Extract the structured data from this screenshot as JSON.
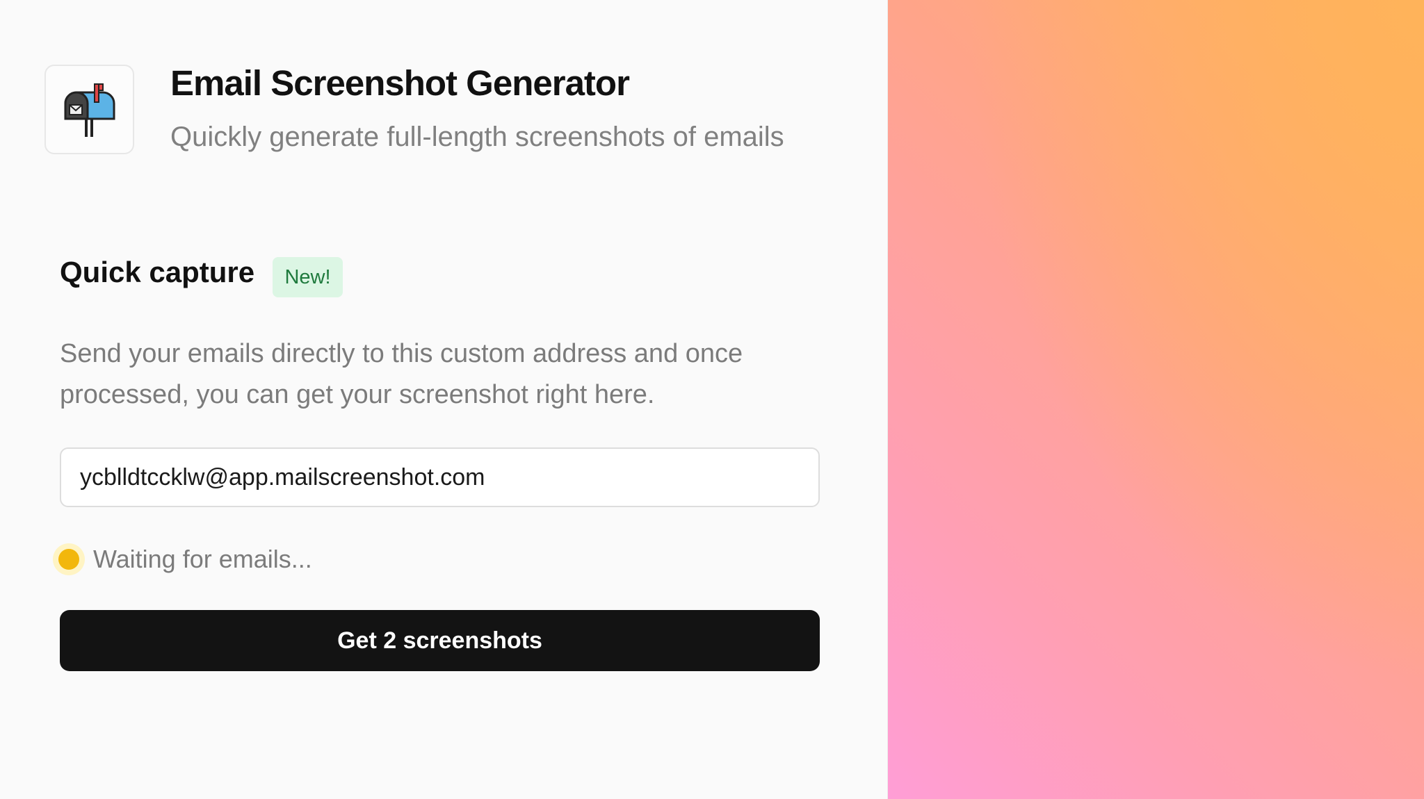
{
  "header": {
    "icon": "mailbox-icon",
    "title": "Email Screenshot Generator",
    "subtitle": "Quickly generate full-length screenshots of emails"
  },
  "quick_capture": {
    "title": "Quick capture",
    "badge": "New!",
    "description": "Send your emails directly to this custom address and once processed, you can get your screenshot right here.",
    "email_value": "ycblldtccklw@app.mailscreenshot.com",
    "status_text": "Waiting for emails...",
    "status_color": "#f2b70c",
    "button_label": "Get 2 screenshots"
  },
  "colors": {
    "badge_bg": "#dcf6e4",
    "badge_text": "#1f7a3d",
    "button_bg": "#131313",
    "gradient": [
      "#ffb062",
      "#ffa48a",
      "#ff9fb4",
      "#ff9ed6"
    ]
  }
}
